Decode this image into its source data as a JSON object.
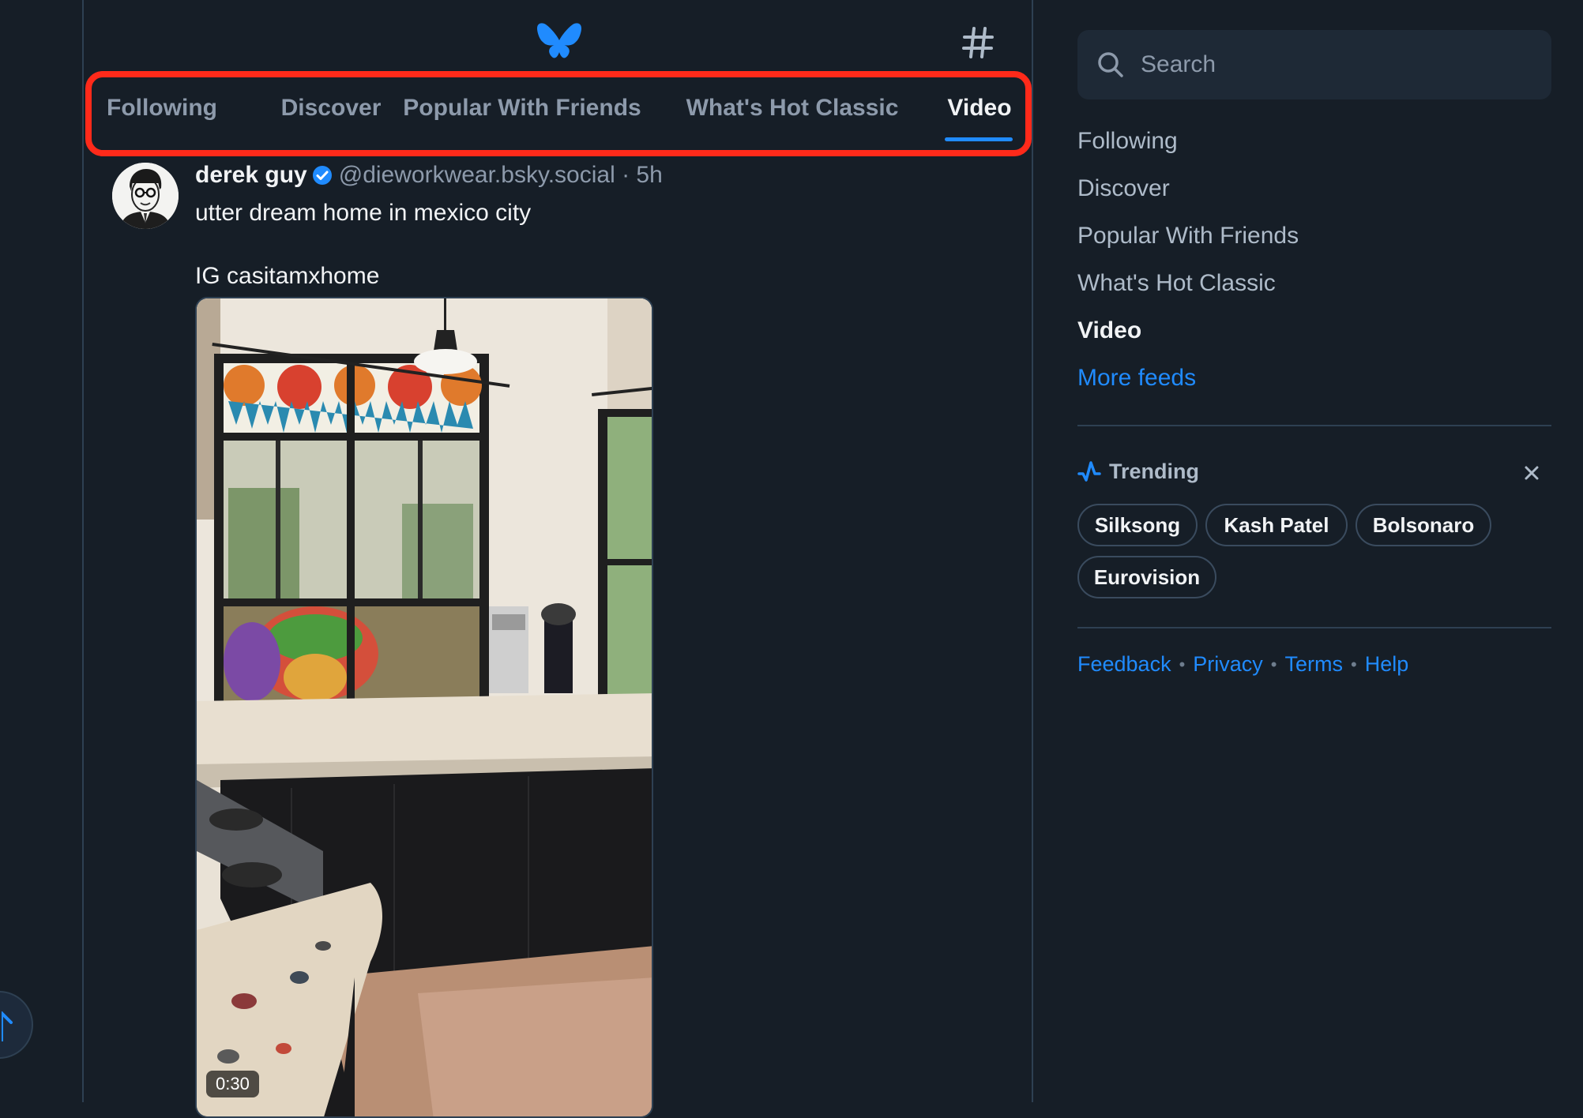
{
  "feed_tabs": [
    {
      "label": "Following",
      "active": false
    },
    {
      "label": "Discover",
      "active": false
    },
    {
      "label": "Popular With Friends",
      "active": false
    },
    {
      "label": "What's Hot Classic",
      "active": false
    },
    {
      "label": "Video",
      "active": true
    }
  ],
  "post": {
    "author_name": "derek guy",
    "verified": true,
    "handle_time": "@dieworkwear.bsky.social · 5h",
    "text_line1": "utter dream home in mexico city",
    "text_line2": "IG casitamxhome",
    "video_duration": "0:30"
  },
  "search": {
    "placeholder": "Search"
  },
  "sidebar_feeds": [
    {
      "label": "Following",
      "active": false
    },
    {
      "label": "Discover",
      "active": false
    },
    {
      "label": "Popular With Friends",
      "active": false
    },
    {
      "label": "What's Hot Classic",
      "active": false
    },
    {
      "label": "Video",
      "active": true
    }
  ],
  "more_feeds_label": "More feeds",
  "trending": {
    "title": "Trending",
    "topics": [
      "Silksong",
      "Kash Patel",
      "Bolsonaro",
      "Eurovision"
    ]
  },
  "footer_links": [
    "Feedback",
    "Privacy",
    "Terms",
    "Help"
  ],
  "colors": {
    "background": "#161e27",
    "accent": "#208bfe",
    "highlight_outline": "#ff2a1a"
  },
  "icons": {
    "logo": "butterfly-logo-icon",
    "hash": "hashtag-icon",
    "search": "search-icon",
    "trending": "trending-icon",
    "close": "close-icon",
    "verified": "verified-check-icon",
    "scroll_top": "arrow-up-icon"
  }
}
